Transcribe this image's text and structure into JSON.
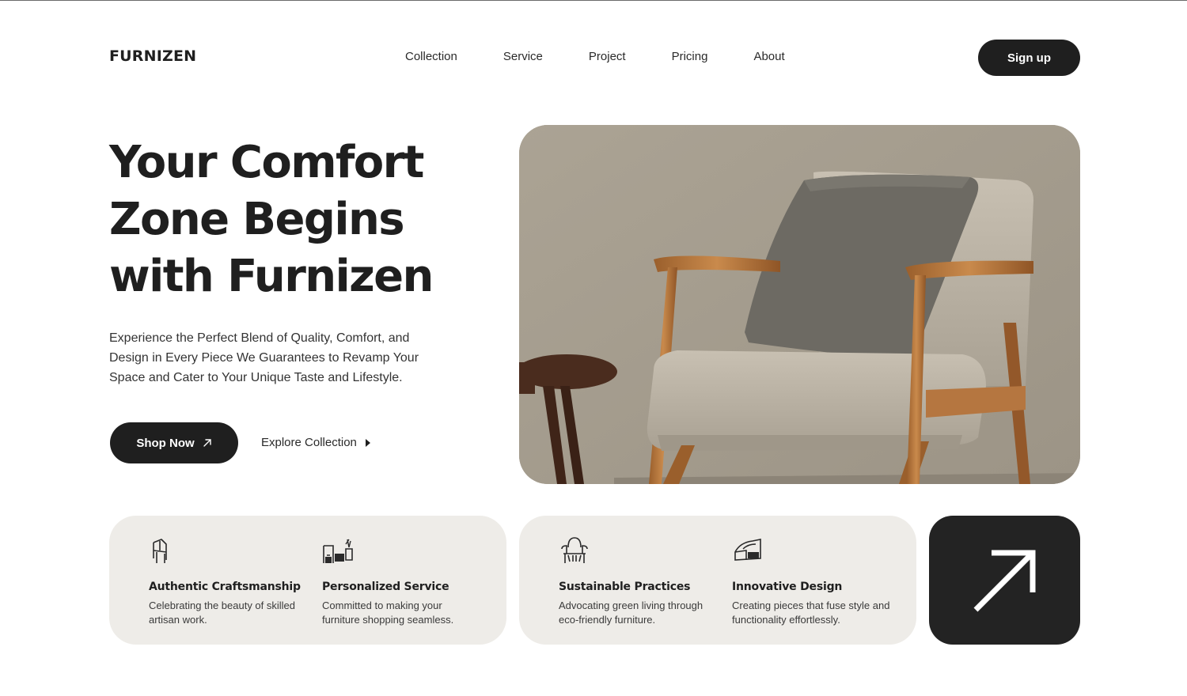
{
  "brand": {
    "name": "FURNIZEN"
  },
  "nav": {
    "items": [
      {
        "label": "Collection"
      },
      {
        "label": "Service"
      },
      {
        "label": "Project"
      },
      {
        "label": "Pricing"
      },
      {
        "label": "About"
      }
    ],
    "signup_label": "Sign up"
  },
  "hero": {
    "title_lines": [
      "Your Comfort",
      "Zone Begins",
      "with Furnizen"
    ],
    "description": "Experience the Perfect Blend of Quality, Comfort, and Design in Every Piece We Guarantees to Revamp Your Space and Cater to Your Unique Taste and Lifestyle.",
    "shop_label": "Shop Now",
    "explore_label": "Explore Collection"
  },
  "features": [
    {
      "icon": "chair-icon",
      "title": "Authentic Craftsmanship",
      "description": "Celebrating the beauty of skilled artisan work."
    },
    {
      "icon": "furniture-set-icon",
      "title": "Personalized Service",
      "description": "Committed to making your furniture shopping seamless."
    },
    {
      "icon": "armchair-icon",
      "title": "Sustainable Practices",
      "description": "Advocating green living through eco-friendly furniture."
    },
    {
      "icon": "sofa-icon",
      "title": "Innovative Design",
      "description": "Creating pieces that fuse style and functionality effortlessly."
    }
  ],
  "colors": {
    "dark": "#1f1f1f",
    "card_bg": "#eeece8",
    "image_wall": "#a69e92"
  },
  "icons": {
    "shop_arrow": "arrow-up-right-icon",
    "explore_arrow": "play-triangle-icon",
    "tile_arrow": "arrow-up-right-icon"
  }
}
